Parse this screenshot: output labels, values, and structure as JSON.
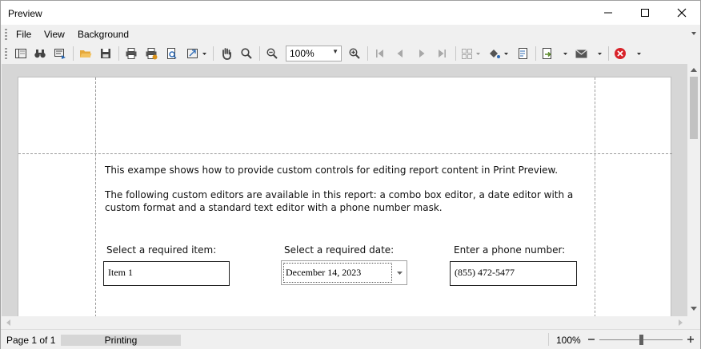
{
  "window": {
    "title": "Preview"
  },
  "menu": {
    "items": [
      "File",
      "View",
      "Background"
    ]
  },
  "toolbar": {
    "zoom_value": "100%"
  },
  "document": {
    "paragraph1": "This exampe shows how to provide custom controls for editing report content in Print Preview.",
    "paragraph2_line1": "The following custom editors are available in this report: a combo box editor, a date editor with a",
    "paragraph2_line2": "custom format and a standard text editor with a phone number mask.",
    "combo_label": "Select a required item:",
    "combo_value": "Item 1",
    "date_label": "Select a required date:",
    "date_value": "December 14, 2023",
    "phone_label": "Enter a phone number:",
    "phone_value": "(855) 472-5477"
  },
  "status": {
    "page_info": "Page 1 of 1",
    "progress_label": "Printing",
    "zoom": "100%",
    "zoom_fraction": 0.5
  },
  "colors": {
    "accent_green": "#5a8a2a",
    "accent_orange": "#d9921c",
    "accent_blue": "#2e6bb5",
    "accent_red": "#d8232a"
  }
}
